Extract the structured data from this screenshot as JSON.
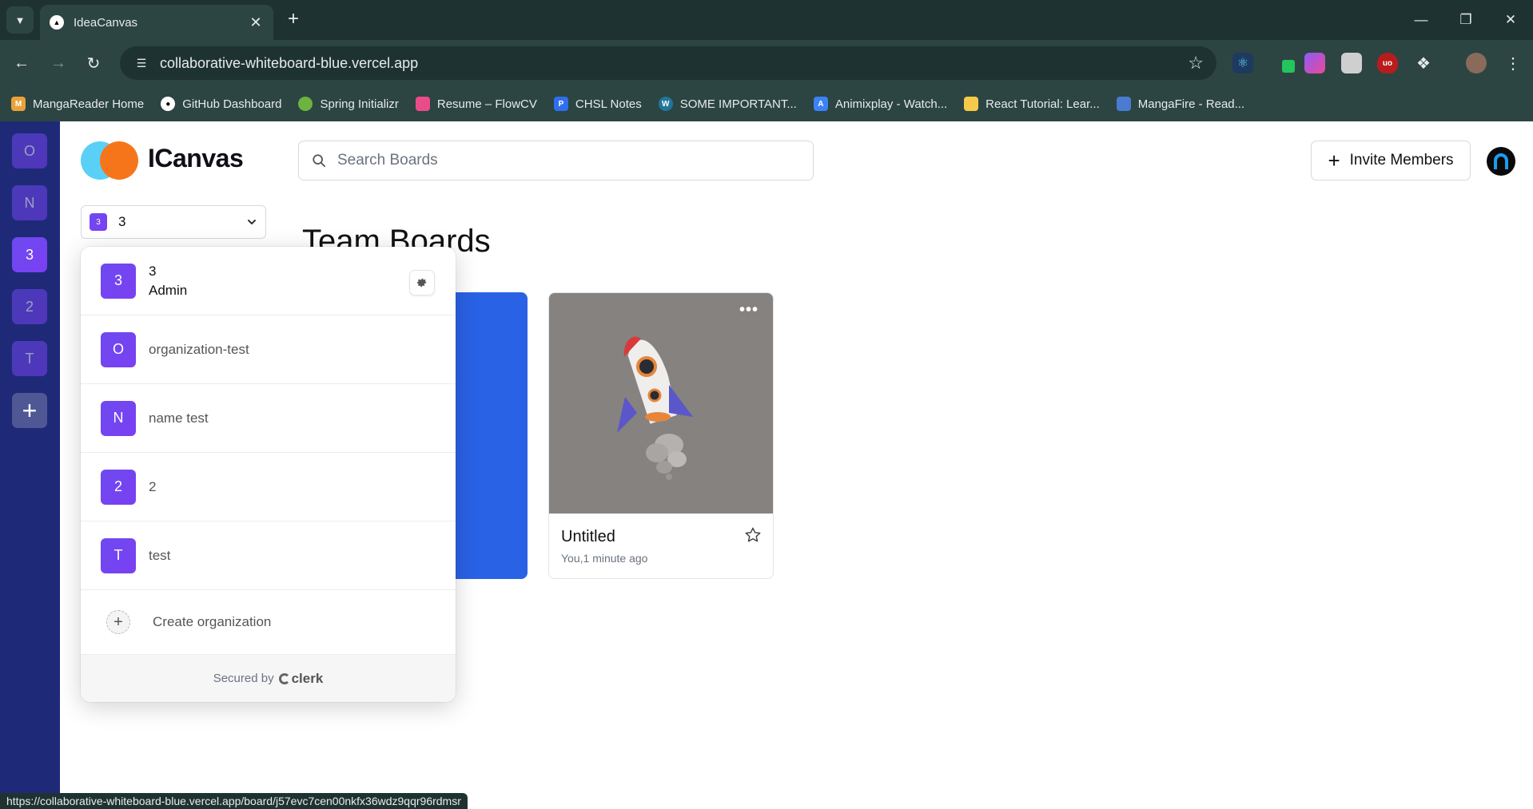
{
  "browser": {
    "tab_title": "IdeaCanvas",
    "url": "collaborative-whiteboard-blue.vercel.app",
    "status_url": "https://collaborative-whiteboard-blue.vercel.app/board/j57evc7cen00nkfx36wdz9qqr96rdmsr",
    "bookmarks": [
      {
        "label": "MangaReader Home",
        "icon_color": "#e9a23b"
      },
      {
        "label": "GitHub Dashboard",
        "icon_color": "#ffffff"
      },
      {
        "label": "Spring Initializr",
        "icon_color": "#6db33f"
      },
      {
        "label": "Resume – FlowCV",
        "icon_color": "#ea4c89"
      },
      {
        "label": "CHSL Notes",
        "icon_color": "#2f6fed"
      },
      {
        "label": "SOME IMPORTANT...",
        "icon_color": "#21759b"
      },
      {
        "label": "Animixplay - Watch...",
        "icon_color": "#3b82f6"
      },
      {
        "label": "React Tutorial: Lear...",
        "icon_color": "#f7c948"
      },
      {
        "label": "MangaFire - Read...",
        "icon_color": "#4a7bd0"
      }
    ]
  },
  "org_sidebar": {
    "items": [
      {
        "label": "O"
      },
      {
        "label": "N"
      },
      {
        "label": "3"
      },
      {
        "label": "2"
      },
      {
        "label": "T"
      }
    ]
  },
  "header": {
    "brand": "ICanvas",
    "search_placeholder": "Search Boards",
    "invite_label": "Invite Members"
  },
  "switcher": {
    "avatar": "3",
    "label": "3"
  },
  "main": {
    "title": "Team Boards",
    "board": {
      "title": "Untitled",
      "meta": "You,1 minute ago"
    }
  },
  "dropdown": {
    "active": {
      "avatar": "3",
      "name": "3",
      "role": "Admin"
    },
    "orgs": [
      {
        "avatar": "O",
        "name": "organization-test"
      },
      {
        "avatar": "N",
        "name": "name test"
      },
      {
        "avatar": "2",
        "name": "2"
      },
      {
        "avatar": "T",
        "name": "test"
      }
    ],
    "create_label": "Create organization",
    "footer_text": "Secured by",
    "footer_brand": "clerk"
  },
  "colors": {
    "sidebar": "#1e2a78",
    "accent": "#2a62e6",
    "org_avatar": "#6d4af0"
  }
}
